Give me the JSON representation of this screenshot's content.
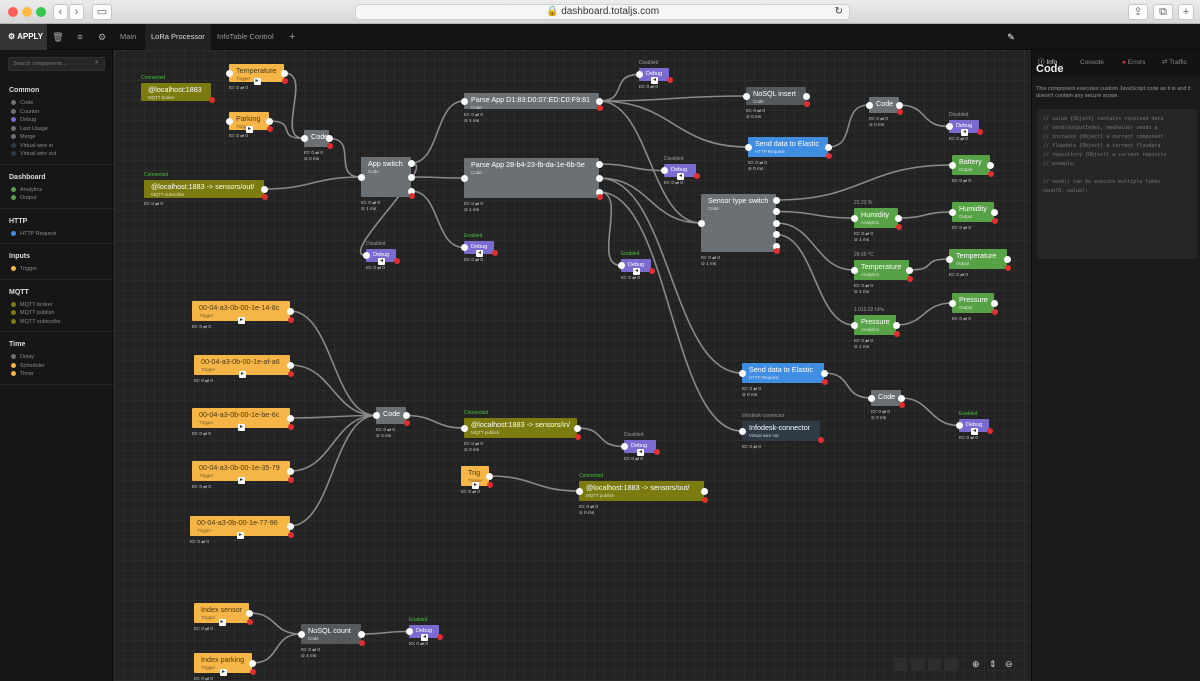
{
  "browser": {
    "url": "dashboard.totaljs.com"
  },
  "toolbar": {
    "apply": "APPLY",
    "tabs": [
      "Main",
      "LoRa Processor",
      "InfoTable Control"
    ],
    "add": "+"
  },
  "left": {
    "search_placeholder": "Search components...",
    "groups": [
      {
        "title": "Common",
        "items": [
          {
            "label": "Code",
            "color": "#6b7074"
          },
          {
            "label": "Counter",
            "color": "#6b7074"
          },
          {
            "label": "Debug",
            "color": "#7a6bd1"
          },
          {
            "label": "Last Usage",
            "color": "#6b7074"
          },
          {
            "label": "Merge",
            "color": "#6b7074"
          },
          {
            "label": "Virtual wire in",
            "color": "#2e3a46"
          },
          {
            "label": "Virtual wire out",
            "color": "#2e3a46"
          }
        ]
      },
      {
        "title": "Dashboard",
        "items": [
          {
            "label": "Analytics",
            "color": "#57a146"
          },
          {
            "label": "Output",
            "color": "#57a146"
          }
        ]
      },
      {
        "title": "HTTP",
        "items": [
          {
            "label": "HTTP Request",
            "color": "#3f8ee2"
          }
        ]
      },
      {
        "title": "Inputs",
        "items": [
          {
            "label": "Trigger",
            "color": "#f6b547"
          }
        ]
      },
      {
        "title": "MQTT",
        "items": [
          {
            "label": "MQTT broker",
            "color": "#7b7b0f"
          },
          {
            "label": "MQTT publish",
            "color": "#7b7b0f"
          },
          {
            "label": "MQTT subscribe",
            "color": "#7b7b0f"
          }
        ]
      },
      {
        "title": "Time",
        "items": [
          {
            "label": "Delay",
            "color": "#6b7074"
          },
          {
            "label": "Scheduler",
            "color": "#f6b547"
          },
          {
            "label": "Timer",
            "color": "#f6b547"
          }
        ]
      }
    ]
  },
  "right": {
    "tabs": [
      "Info",
      "Console",
      "Errors",
      "Traffic"
    ],
    "title": "Code",
    "description": "This component executes custom JavaScript code as it is and it doesn't contain any secure scope.",
    "code": "// value {Object} contains received data\n// send(outputIndex, newValue) sends a\n// instance {Object} a current component\n// flowdata {Object} a current flowdata\n// repository {Object} a current reposito\n// example:\n\n// send() can be execute multiple times\nsend(0, value);"
  },
  "nodes": [
    {
      "id": "broker",
      "title": "@localhost:1883",
      "sub": "MQTT broker",
      "status": "Connected",
      "stats": ""
    },
    {
      "id": "temp",
      "title": "Temperature",
      "sub": "Trigger",
      "status": "",
      "stats": "IO: 0 ⇄ 0"
    },
    {
      "id": "parking",
      "title": "Parking",
      "sub": "Trigger",
      "status": "",
      "stats": "IO: 0 ⇄ 0"
    },
    {
      "id": "code1",
      "title": "Code",
      "sub": "",
      "status": "",
      "stats": "IO: 0 ⇄ 0|⊘ 0 ms"
    },
    {
      "id": "sub1",
      "title": "@localhost:1883 -> sensors/out/",
      "sub": "MQTT subscribe",
      "status": "Connected",
      "stats": "IO: 0 ⇄ 0"
    },
    {
      "id": "appsw",
      "title": "App switch",
      "sub": "Code",
      "status": "",
      "stats": "IO: 0 ⇄ 0|⊘ 1 ms"
    },
    {
      "id": "dbg1",
      "title": "Debug",
      "sub": "",
      "status": "Disabled",
      "stats": "IO: 0 ⇄ 0"
    },
    {
      "id": "parse1",
      "title": "Parse App D1:83:D0:07:ED:C0:F9:81",
      "sub": "Code",
      "status": "",
      "stats": "IO: 0 ⇄ 0|⊘ 1 ms"
    },
    {
      "id": "dbg2",
      "title": "Debug",
      "sub": "",
      "status": "Disabled",
      "stats": "IO: 0 ⇄ 0"
    },
    {
      "id": "nosql1",
      "title": "NoSQL insert",
      "sub": "Code",
      "status": "",
      "stats": "IO: 0 ⇄ 0|⊘ 0 ms"
    },
    {
      "id": "http1",
      "title": "Send data to Elastic",
      "sub": "HTTP Request",
      "status": "",
      "stats": "IO: 0 ⇄ 0|⊘ 0 ms"
    },
    {
      "id": "code2",
      "title": "Code",
      "sub": "",
      "status": "",
      "stats": "IO: 0 ⇄ 0|⊘ 0 ms"
    },
    {
      "id": "dbg3",
      "title": "Debug",
      "sub": "",
      "status": "Disabled",
      "stats": "IO: 0 ⇄ 0"
    },
    {
      "id": "parse2",
      "title": "Parse App 28-b4-23-fb-da-1e-6b-5e",
      "sub": "Code",
      "status": "",
      "stats": "IO: 0 ⇄ 0|⊘ 1 ms"
    },
    {
      "id": "dbg4",
      "title": "Debug",
      "sub": "",
      "status": "Disabled",
      "stats": "IO: 0 ⇄ 0"
    },
    {
      "id": "battery",
      "title": "Battery",
      "sub": "Output",
      "status": "",
      "stats": "IO: 0 ⇄ 0"
    },
    {
      "id": "dbg5",
      "title": "Debug",
      "sub": "",
      "status": "Enabled",
      "stats": "IO: 0 ⇄ 0"
    },
    {
      "id": "sensw",
      "title": "Sensor type switch",
      "sub": "Code",
      "status": "",
      "stats": "IO: 0 ⇄ 0|⊘ 1 ms"
    },
    {
      "id": "hum_a",
      "title": "Humidity",
      "sub": "Analytics",
      "status": "23.23 %",
      "stats": "IO: 0 ⇄ 0|⊘ 1 ms"
    },
    {
      "id": "hum_o",
      "title": "Humidity",
      "sub": "Output",
      "status": "",
      "stats": "IO: 0 ⇄ 0"
    },
    {
      "id": "dbg6",
      "title": "Debug",
      "sub": "",
      "status": "Enabled",
      "stats": "IO: 0 ⇄ 0"
    },
    {
      "id": "tmp_a",
      "title": "Temperature",
      "sub": "Analytics",
      "status": "28.60 °C",
      "stats": "IO: 0 ⇄ 0|⊘ 1 ms"
    },
    {
      "id": "tmp_o",
      "title": "Temperature",
      "sub": "Output",
      "status": "",
      "stats": "IO: 0 ⇄ 0"
    },
    {
      "id": "prs_a",
      "title": "Pressure",
      "sub": "Analytics",
      "status": "1 012.02 hPa",
      "stats": "IO: 0 ⇄ 0|⊘ 1 ms"
    },
    {
      "id": "prs_o",
      "title": "Pressure",
      "sub": "Output",
      "status": "",
      "stats": "IO: 0 ⇄ 0"
    },
    {
      "id": "t1",
      "title": "00-04-a3-0b-00-1e-14-8c",
      "sub": "Trigger",
      "status": "",
      "stats": "IO: 0 ⇄ 0"
    },
    {
      "id": "t2",
      "title": "00-04-a3-0b-00-1e-af-a6",
      "sub": "Trigger",
      "status": "",
      "stats": "IO: 0 ⇄ 0"
    },
    {
      "id": "t3",
      "title": "00-04-a3-0b-00-1e-be-6c",
      "sub": "Trigger",
      "status": "",
      "stats": "IO: 0 ⇄ 0"
    },
    {
      "id": "t4",
      "title": "00-04-a3-0b-00-1e-35-79",
      "sub": "Trigger",
      "status": "",
      "stats": "IO: 0 ⇄ 0"
    },
    {
      "id": "t5",
      "title": "00-04-a3-0b-00-1e-77-96",
      "sub": "Trigger",
      "status": "",
      "stats": "IO: 0 ⇄ 0"
    },
    {
      "id": "code3",
      "title": "Code",
      "sub": "",
      "status": "",
      "stats": "IO: 0 ⇄ 0|⊘ 0 ms"
    },
    {
      "id": "pub1",
      "title": "@localhost:1883 -> sensors/in/",
      "sub": "MQTT publish",
      "status": "Connected",
      "stats": "IO: 0 ⇄ 0|⊘ 0 ms"
    },
    {
      "id": "dbg7",
      "title": "Debug",
      "sub": "",
      "status": "Disabled",
      "stats": "IO: 0 ⇄ 0"
    },
    {
      "id": "tr",
      "title": "Trig",
      "sub": "Trigger",
      "status": "",
      "stats": "IO: 0 ⇄ 0"
    },
    {
      "id": "pub2",
      "title": "@localhost:1883 -> sensors/out/",
      "sub": "MQTT publish",
      "status": "Connected",
      "stats": "IO: 0 ⇄ 0|⊘ 0 ms"
    },
    {
      "id": "http2",
      "title": "Send data to Elastic",
      "sub": "HTTP Request",
      "status": "",
      "stats": "IO: 0 ⇄ 0|⊘ 0 ms"
    },
    {
      "id": "code4",
      "title": "Code",
      "sub": "",
      "status": "",
      "stats": "IO: 0 ⇄ 0|⊘ 0 ms"
    },
    {
      "id": "vwo",
      "title": "Infodesk-connector",
      "sub": "Virtual wire out",
      "status": "Infodesk-connector",
      "stats": "IO: 0 ⇄ 0"
    },
    {
      "id": "dbg8",
      "title": "Debug",
      "sub": "",
      "status": "Enabled",
      "stats": "IO: 0 ⇄ 0"
    },
    {
      "id": "isens",
      "title": "Index sensor",
      "sub": "Trigger",
      "status": "",
      "stats": "IO: 0 ⇄ 0"
    },
    {
      "id": "ipark",
      "title": "Index parking",
      "sub": "Trigger",
      "status": "",
      "stats": "IO: 0 ⇄ 0"
    },
    {
      "id": "nosql2",
      "title": "NoSQL count",
      "sub": "Code",
      "status": "",
      "stats": "IO: 0 ⇄ 0|⊘ 4 ms"
    },
    {
      "id": "dbg9",
      "title": "Debug",
      "sub": "",
      "status": "Enabled",
      "stats": "IO: 0 ⇄ 0"
    }
  ]
}
